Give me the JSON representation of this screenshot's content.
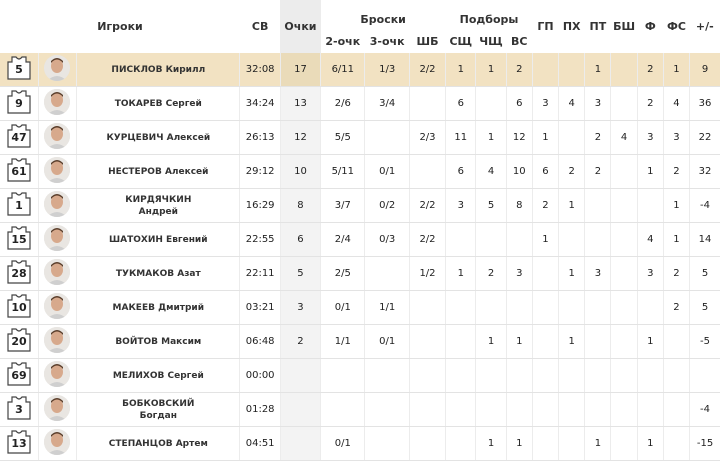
{
  "headers": {
    "players": "Игроки",
    "minutes": "СВ",
    "points": "Очки",
    "shots": "Броски",
    "shots_sub": [
      "2-очк",
      "3-очк",
      "ШБ"
    ],
    "rebounds": "Подборы",
    "rebounds_sub": [
      "СЩ",
      "ЧЩ",
      "ВС"
    ],
    "gp": "ГП",
    "ph": "ПХ",
    "pt": "ПТ",
    "bsh": "БШ",
    "f": "Ф",
    "fs": "ФС",
    "pm": "+/-"
  },
  "players": [
    {
      "num": "5",
      "name": "ПИСКЛОВ Кирилл",
      "min": "32:08",
      "pts": "17",
      "p2": "6/11",
      "p3": "1/3",
      "ft": "2/2",
      "orb": "1",
      "drb": "1",
      "trb": "2",
      "gp": "",
      "ph": "",
      "pt": "1",
      "bsh": "",
      "f": "2",
      "fs": "1",
      "pm": "9",
      "highlight": true
    },
    {
      "num": "9",
      "name": "ТОКАРЕВ Сергей",
      "min": "34:24",
      "pts": "13",
      "p2": "2/6",
      "p3": "3/4",
      "ft": "",
      "orb": "6",
      "drb": "",
      "trb": "6",
      "gp": "3",
      "ph": "4",
      "pt": "3",
      "bsh": "",
      "f": "2",
      "fs": "4",
      "pm": "36"
    },
    {
      "num": "47",
      "name": "КУРЦЕВИЧ Алексей",
      "min": "26:13",
      "pts": "12",
      "p2": "5/5",
      "p3": "",
      "ft": "2/3",
      "orb": "11",
      "drb": "1",
      "trb": "12",
      "gp": "1",
      "ph": "",
      "pt": "2",
      "bsh": "4",
      "f": "3",
      "fs": "3",
      "pm": "22"
    },
    {
      "num": "61",
      "name": "НЕСТЕРОВ Алексей",
      "min": "29:12",
      "pts": "10",
      "p2": "5/11",
      "p3": "0/1",
      "ft": "",
      "orb": "6",
      "drb": "4",
      "trb": "10",
      "gp": "6",
      "ph": "2",
      "pt": "2",
      "bsh": "",
      "f": "1",
      "fs": "2",
      "pm": "32"
    },
    {
      "num": "1",
      "name_lines": [
        "КИРДЯЧКИН",
        "Андрей"
      ],
      "min": "16:29",
      "pts": "8",
      "p2": "3/7",
      "p3": "0/2",
      "ft": "2/2",
      "orb": "3",
      "drb": "5",
      "trb": "8",
      "gp": "2",
      "ph": "1",
      "pt": "",
      "bsh": "",
      "f": "",
      "fs": "1",
      "pm": "-4"
    },
    {
      "num": "15",
      "name": "ШАТОХИН Евгений",
      "min": "22:55",
      "pts": "6",
      "p2": "2/4",
      "p3": "0/3",
      "ft": "2/2",
      "orb": "",
      "drb": "",
      "trb": "",
      "gp": "1",
      "ph": "",
      "pt": "",
      "bsh": "",
      "f": "4",
      "fs": "1",
      "pm": "14"
    },
    {
      "num": "28",
      "name": "ТУКМАКОВ Азат",
      "min": "22:11",
      "pts": "5",
      "p2": "2/5",
      "p3": "",
      "ft": "1/2",
      "orb": "1",
      "drb": "2",
      "trb": "3",
      "gp": "",
      "ph": "1",
      "pt": "3",
      "bsh": "",
      "f": "3",
      "fs": "2",
      "pm": "5"
    },
    {
      "num": "10",
      "name": "МАКЕЕВ Дмитрий",
      "min": "03:21",
      "pts": "3",
      "p2": "0/1",
      "p3": "1/1",
      "ft": "",
      "orb": "",
      "drb": "",
      "trb": "",
      "gp": "",
      "ph": "",
      "pt": "",
      "bsh": "",
      "f": "",
      "fs": "2",
      "pm": "5"
    },
    {
      "num": "20",
      "name": "ВОЙТОВ Максим",
      "min": "06:48",
      "pts": "2",
      "p2": "1/1",
      "p3": "0/1",
      "ft": "",
      "orb": "",
      "drb": "1",
      "trb": "1",
      "gp": "",
      "ph": "1",
      "pt": "",
      "bsh": "",
      "f": "1",
      "fs": "",
      "pm": "-5"
    },
    {
      "num": "69",
      "name": "МЕЛИХОВ Сергей",
      "min": "00:00",
      "pts": "",
      "p2": "",
      "p3": "",
      "ft": "",
      "orb": "",
      "drb": "",
      "trb": "",
      "gp": "",
      "ph": "",
      "pt": "",
      "bsh": "",
      "f": "",
      "fs": "",
      "pm": ""
    },
    {
      "num": "3",
      "name_lines": [
        "БОБКОВСКИЙ",
        "Богдан"
      ],
      "min": "01:28",
      "pts": "",
      "p2": "",
      "p3": "",
      "ft": "",
      "orb": "",
      "drb": "",
      "trb": "",
      "gp": "",
      "ph": "",
      "pt": "",
      "bsh": "",
      "f": "",
      "fs": "",
      "pm": "-4"
    },
    {
      "num": "13",
      "name": "СТЕПАНЦОВ Артем",
      "min": "04:51",
      "pts": "",
      "p2": "0/1",
      "p3": "",
      "ft": "",
      "orb": "",
      "drb": "1",
      "trb": "1",
      "gp": "",
      "ph": "",
      "pt": "1",
      "bsh": "",
      "f": "1",
      "fs": "",
      "pm": "-15"
    }
  ],
  "colors": {
    "highlight_row": "#f2e2c2",
    "points_col": "#f3f3f3",
    "grid": "#e3e3e3"
  }
}
